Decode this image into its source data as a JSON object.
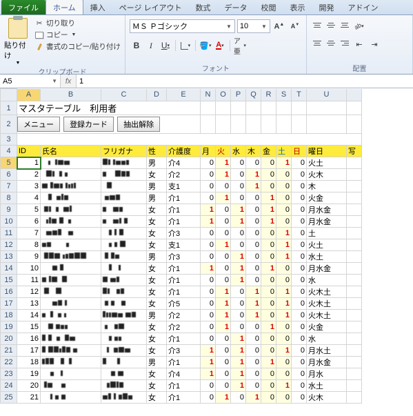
{
  "tabs": {
    "file": "ファイル",
    "items": [
      "ホーム",
      "挿入",
      "ページ レイアウト",
      "数式",
      "データ",
      "校閲",
      "表示",
      "開発",
      "アドイン"
    ],
    "active": 0
  },
  "clipboard": {
    "paste": "貼り付け",
    "cut": "切り取り",
    "copy": "コピー",
    "brush": "書式のコピー/貼り付け",
    "group": "クリップボード"
  },
  "font": {
    "name": "ＭＳ Ｐゴシック",
    "size": "10",
    "group": "フォント"
  },
  "align": {
    "group": "配置"
  },
  "namebox": "A5",
  "fx_label": "fx",
  "fx_value": "1",
  "columns": [
    "A",
    "B",
    "C",
    "D",
    "E",
    "N",
    "O",
    "P",
    "Q",
    "R",
    "S",
    "T",
    "U"
  ],
  "title": "マスタテーブル　利用者",
  "buttons": [
    "メニュー",
    "登録カード",
    "抽出解除"
  ],
  "headers": {
    "id": "ID",
    "name": "氏名",
    "kana": "フリガナ",
    "sex": "性",
    "care": "介護度",
    "days": [
      "月",
      "火",
      "水",
      "木",
      "金",
      "土",
      "日"
    ],
    "weekday": "曜日",
    "photo": "写"
  },
  "rows": [
    {
      "r": 5,
      "id": 1,
      "sex": "男",
      "care": "介4",
      "d": [
        0,
        1,
        0,
        0,
        0,
        1,
        0
      ],
      "wd": "火土"
    },
    {
      "r": 6,
      "id": 2,
      "sex": "女",
      "care": "介2",
      "d": [
        0,
        1,
        0,
        1,
        0,
        0,
        0
      ],
      "wd": "火木"
    },
    {
      "r": 7,
      "id": 3,
      "sex": "男",
      "care": "支1",
      "d": [
        0,
        0,
        0,
        1,
        0,
        0,
        0
      ],
      "wd": "木"
    },
    {
      "r": 8,
      "id": 4,
      "sex": "男",
      "care": "介1",
      "d": [
        0,
        1,
        0,
        0,
        1,
        0,
        0
      ],
      "wd": "火金"
    },
    {
      "r": 9,
      "id": 5,
      "sex": "女",
      "care": "介1",
      "d": [
        1,
        0,
        1,
        0,
        1,
        0,
        0
      ],
      "wd": "月水金"
    },
    {
      "r": 10,
      "id": 6,
      "sex": "女",
      "care": "介1",
      "d": [
        1,
        0,
        1,
        0,
        1,
        0,
        0
      ],
      "wd": "月水金"
    },
    {
      "r": 11,
      "id": 7,
      "sex": "女",
      "care": "介3",
      "d": [
        0,
        0,
        0,
        0,
        0,
        1,
        0
      ],
      "wd": "土"
    },
    {
      "r": 12,
      "id": 8,
      "sex": "女",
      "care": "支1",
      "d": [
        0,
        1,
        0,
        0,
        0,
        1,
        0
      ],
      "wd": "火土"
    },
    {
      "r": 13,
      "id": 9,
      "sex": "男",
      "care": "介3",
      "d": [
        0,
        0,
        1,
        0,
        0,
        1,
        0
      ],
      "wd": "水土"
    },
    {
      "r": 14,
      "id": 10,
      "sex": "女",
      "care": "介1",
      "d": [
        1,
        0,
        1,
        0,
        1,
        0,
        0
      ],
      "wd": "月水金"
    },
    {
      "r": 15,
      "id": 11,
      "sex": "女",
      "care": "介1",
      "d": [
        0,
        0,
        1,
        0,
        0,
        0,
        0
      ],
      "wd": "水"
    },
    {
      "r": 16,
      "id": 12,
      "sex": "女",
      "care": "介1",
      "d": [
        0,
        1,
        0,
        1,
        0,
        1,
        0
      ],
      "wd": "火木土"
    },
    {
      "r": 17,
      "id": 13,
      "sex": "女",
      "care": "介5",
      "d": [
        0,
        1,
        0,
        1,
        0,
        1,
        0
      ],
      "wd": "火木土"
    },
    {
      "r": 18,
      "id": 14,
      "sex": "男",
      "care": "介2",
      "d": [
        0,
        1,
        0,
        1,
        0,
        1,
        0
      ],
      "wd": "火木土"
    },
    {
      "r": 19,
      "id": 15,
      "sex": "女",
      "care": "介2",
      "d": [
        0,
        1,
        0,
        0,
        1,
        0,
        0
      ],
      "wd": "火金"
    },
    {
      "r": 20,
      "id": 16,
      "sex": "女",
      "care": "介1",
      "d": [
        0,
        0,
        1,
        0,
        0,
        0,
        0
      ],
      "wd": "水"
    },
    {
      "r": 21,
      "id": 17,
      "sex": "女",
      "care": "介3",
      "d": [
        1,
        0,
        1,
        0,
        0,
        1,
        0
      ],
      "wd": "月水土"
    },
    {
      "r": 22,
      "id": 18,
      "sex": "男",
      "care": "介1",
      "d": [
        1,
        0,
        1,
        0,
        1,
        0,
        0
      ],
      "wd": "月水金"
    },
    {
      "r": 23,
      "id": 19,
      "sex": "女",
      "care": "介4",
      "d": [
        1,
        0,
        1,
        0,
        0,
        0,
        0
      ],
      "wd": "月水"
    },
    {
      "r": 24,
      "id": 20,
      "sex": "女",
      "care": "介1",
      "d": [
        0,
        0,
        1,
        0,
        0,
        1,
        0
      ],
      "wd": "水土"
    },
    {
      "r": 25,
      "id": 21,
      "sex": "女",
      "care": "介1",
      "d": [
        0,
        1,
        0,
        1,
        0,
        0,
        0
      ],
      "wd": "火木"
    }
  ]
}
